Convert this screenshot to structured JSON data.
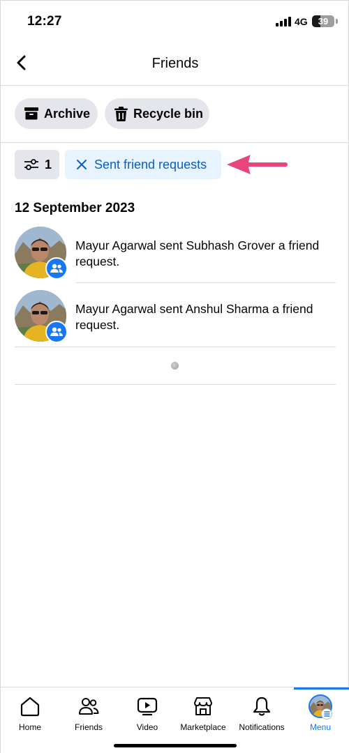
{
  "status_bar": {
    "time": "12:27",
    "network": "4G",
    "battery": "39",
    "battery_level": 0.39
  },
  "header": {
    "title": "Friends",
    "back_icon": "chevron-left-icon"
  },
  "actions": {
    "archive_label": "Archive",
    "archive_icon": "archive-box-icon",
    "recycle_label": "Recycle bin",
    "recycle_icon": "trash-icon"
  },
  "filter": {
    "count": "1",
    "icon": "sliders-icon",
    "chip_label": "Sent friend requests",
    "chip_icon": "close-icon",
    "chip_color": "#0a5ec4",
    "chip_bg": "#e7f3ff",
    "arrow_color": "#e8457a"
  },
  "feed": {
    "date": "12 September 2023",
    "items": [
      {
        "text": "Mayur Agarwal sent Subhash Grover a friend request.",
        "badge_icon": "friends-icon"
      },
      {
        "text": "Mayur Agarwal sent Anshul Sharma a friend request.",
        "badge_icon": "friends-icon"
      }
    ]
  },
  "nav": {
    "accent": "#1877f2",
    "items": [
      {
        "label": "Home",
        "icon": "home-icon"
      },
      {
        "label": "Friends",
        "icon": "friends-icon"
      },
      {
        "label": "Video",
        "icon": "video-icon"
      },
      {
        "label": "Marketplace",
        "icon": "marketplace-icon"
      },
      {
        "label": "Notifications",
        "icon": "bell-icon"
      },
      {
        "label": "Menu",
        "icon": "profile-avatar-icon",
        "active": true
      }
    ]
  }
}
